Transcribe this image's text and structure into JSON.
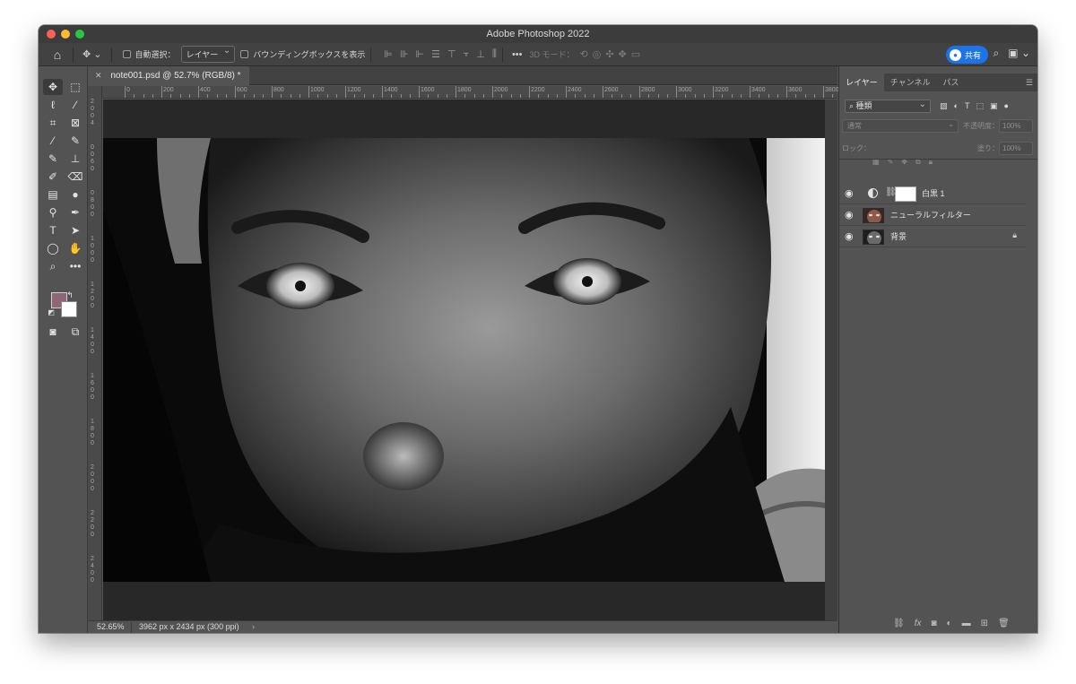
{
  "app": {
    "title": "Adobe Photoshop 2022"
  },
  "options_bar": {
    "auto_select_label": "自動選択：",
    "auto_select_value": "レイヤー",
    "bounding_box_label": "バウンディングボックスを表示",
    "mode_3d_label": "3D モード：",
    "share_label": "共有"
  },
  "document": {
    "tab_label": "note001.psd @ 52.7% (RGB/8) *",
    "zoom": "52.65%",
    "info": "3962 px x 2434 px (300 ppi)"
  },
  "rulers": {
    "horizontal": [
      "0",
      "200",
      "400",
      "600",
      "800",
      "1000",
      "1200",
      "1400",
      "1600",
      "1800",
      "2000",
      "2200",
      "2400",
      "2600",
      "2800",
      "3000",
      "3200",
      "3400",
      "3600",
      "3800"
    ],
    "vertical": [
      "2",
      "0",
      "0",
      "4",
      "0",
      "0",
      "6",
      "0",
      "0",
      "8",
      "0",
      "0",
      "1",
      "0",
      "0",
      "0",
      "1",
      "2",
      "0",
      "0",
      "1",
      "4",
      "0",
      "0",
      "1",
      "6",
      "0",
      "0",
      "1",
      "8",
      "0",
      "0",
      "2",
      "0",
      "0",
      "0",
      "2",
      "2",
      "0",
      "0",
      "2",
      "4",
      "0",
      "0"
    ]
  },
  "tools": {
    "foreground_color": "#8d6677",
    "background_color": "#ffffff"
  },
  "layers_panel": {
    "tabs": [
      "レイヤー",
      "チャンネル",
      "パス"
    ],
    "filter_label": "種類",
    "blend_mode": "通常",
    "opacity_label": "不透明度：",
    "opacity_value": "100%",
    "lock_label": "ロック：",
    "fill_label": "塗り：",
    "fill_value": "100%",
    "layers": [
      {
        "name": "白黒 1",
        "kind": "adjustment",
        "visible": true
      },
      {
        "name": "ニューラルフィルター",
        "kind": "pixel-color",
        "visible": true
      },
      {
        "name": "背景",
        "kind": "background",
        "visible": true,
        "locked": true
      }
    ]
  },
  "colors": {
    "accent": "#1d73e8",
    "panel_bg": "#535353",
    "canvas_bg": "#282828"
  }
}
